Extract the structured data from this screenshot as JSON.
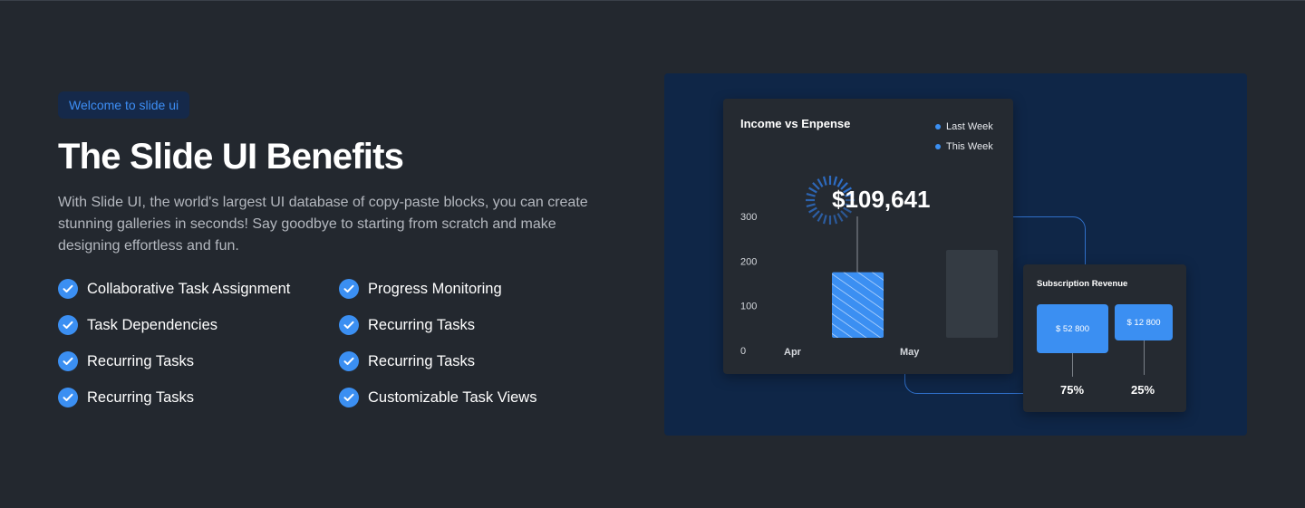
{
  "hero": {
    "badge": "Welcome to slide ui",
    "title": "The Slide UI Benefits",
    "description": "With Slide UI, the world's largest UI database of copy-paste blocks, you can create stunning galleries in seconds! Say goodbye to starting from scratch and make designing effortless and fun."
  },
  "features": [
    {
      "label": "Collaborative Task Assignment",
      "icon": "check-circle-icon"
    },
    {
      "label": "Progress Monitoring",
      "icon": "check-circle-icon"
    },
    {
      "label": "Task Dependencies",
      "icon": "check-circle-icon"
    },
    {
      "label": "Recurring Tasks",
      "icon": "check-circle-icon"
    },
    {
      "label": "Recurring Tasks",
      "icon": "check-circle-icon"
    },
    {
      "label": "Recurring Tasks",
      "icon": "check-circle-icon"
    },
    {
      "label": "Recurring Tasks",
      "icon": "check-circle-icon"
    },
    {
      "label": "Customizable Task Views",
      "icon": "check-circle-icon"
    }
  ],
  "income_card": {
    "title": "Income vs Enpense",
    "legend": [
      "Last Week",
      "This Week"
    ],
    "highlight_value": "$109,641"
  },
  "subscription_card": {
    "title": "Subscription Revenue",
    "amounts": [
      "$ 52 800",
      "$ 12 800"
    ],
    "percentages": [
      "75%",
      "25%"
    ]
  },
  "colors": {
    "background": "#23282f",
    "accent": "#3b8ff2",
    "panel": "#0f2647",
    "card": "#252a31",
    "muted_bar": "#343b43"
  },
  "chart_data": {
    "type": "bar",
    "title": "Income vs Enpense",
    "categories": [
      "Apr",
      "May"
    ],
    "y_ticks": [
      0,
      100,
      200,
      300
    ],
    "ylim": [
      0,
      300
    ],
    "series": [
      {
        "name": "Last Week",
        "values": [
          175,
          null
        ]
      },
      {
        "name": "This Week",
        "values": [
          null,
          225
        ]
      }
    ],
    "legend_position": "top-right",
    "grid": false
  }
}
